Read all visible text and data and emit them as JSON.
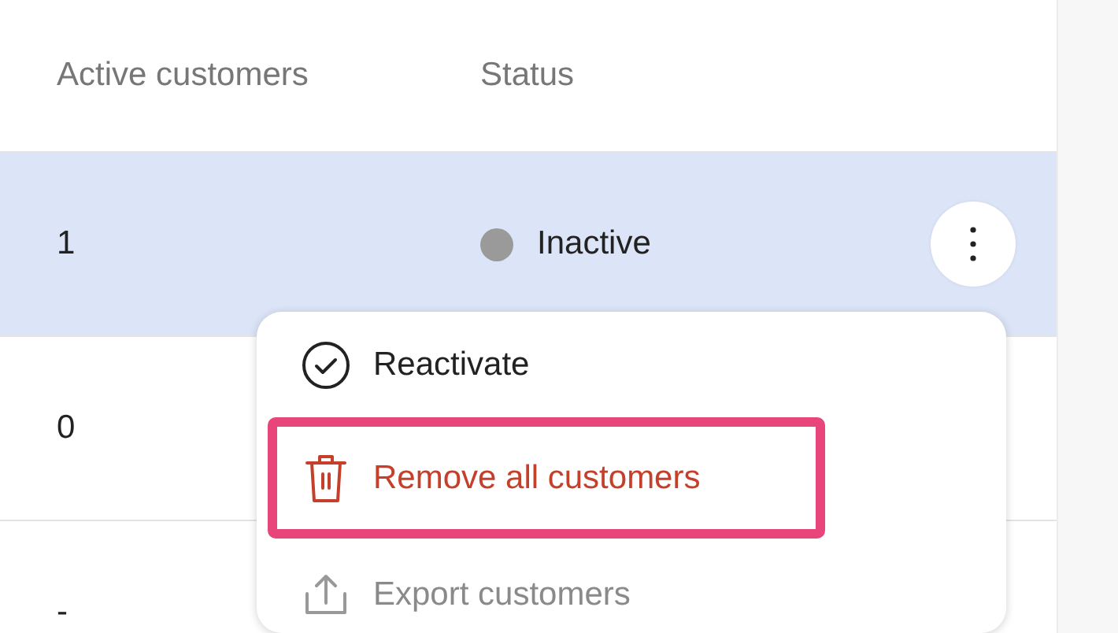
{
  "table": {
    "columns": [
      "Active customers",
      "Status"
    ],
    "rows": [
      {
        "active_customers": "1",
        "status": {
          "label": "Inactive",
          "color": "#9a9a9a"
        },
        "selected": true,
        "menu_button": true
      },
      {
        "active_customers": "0",
        "selected": false,
        "menu_button": false
      },
      {
        "active_customers": "-",
        "selected": false,
        "menu_button": false
      }
    ]
  },
  "row_menu": {
    "items": [
      {
        "label": "Reactivate",
        "kind": "reactivate",
        "disabled": false,
        "highlighted": false
      },
      {
        "label": "Remove all customers",
        "kind": "remove",
        "disabled": false,
        "highlighted": true
      },
      {
        "label": "Export customers",
        "kind": "export",
        "disabled": true,
        "highlighted": false
      }
    ]
  }
}
